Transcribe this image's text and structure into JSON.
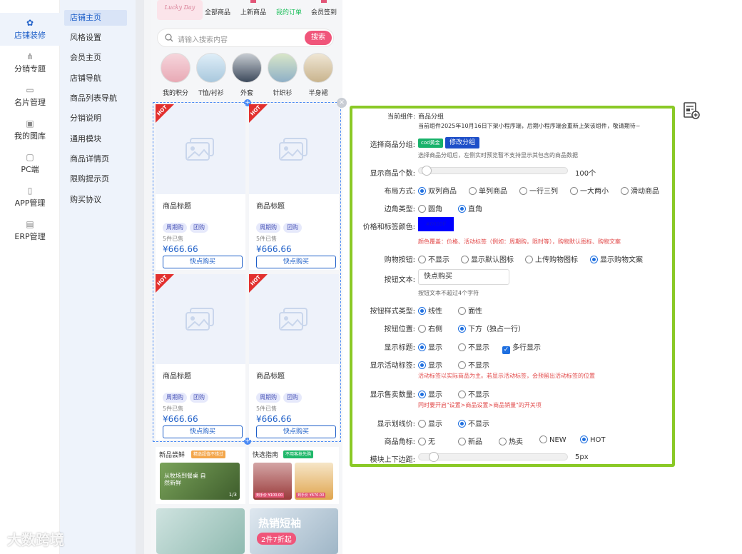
{
  "rail": {
    "items": [
      {
        "label": "店铺装修",
        "icon": "palette-icon"
      },
      {
        "label": "分销专题",
        "icon": "share-icon"
      },
      {
        "label": "名片管理",
        "icon": "card-icon"
      },
      {
        "label": "我的图库",
        "icon": "image-icon"
      },
      {
        "label": "PC端",
        "icon": "monitor-icon"
      },
      {
        "label": "APP管理",
        "icon": "phone-icon"
      },
      {
        "label": "ERP管理",
        "icon": "keyboard-icon"
      }
    ]
  },
  "submenu": {
    "items": [
      "店铺主页",
      "风格设置",
      "会员主页",
      "店铺导航",
      "商品列表导航",
      "分销说明",
      "通用模块",
      "商品详情页",
      "限购提示页",
      "购买协议"
    ]
  },
  "preview": {
    "logo": "Lucky Day",
    "topnav": [
      "全部商品",
      "上新商品",
      "我的订单",
      "会员签到"
    ],
    "search_placeholder": "请输入搜索内容",
    "search_button": "搜索",
    "categories": [
      "我的积分",
      "T恤/衬衫",
      "外套",
      "针织衫",
      "半身裙"
    ],
    "products": [
      {
        "badge": "HOT",
        "title": "商品标题",
        "tags": [
          "周期购",
          "团购"
        ],
        "sold": "5件已售",
        "price": "¥666.66",
        "button": "快点购买"
      },
      {
        "badge": "HOT",
        "title": "商品标题",
        "tags": [
          "周期购",
          "团购"
        ],
        "sold": "5件已售",
        "price": "¥666.66",
        "button": "快点购买"
      },
      {
        "badge": "HOT",
        "title": "商品标题",
        "tags": [
          "周期购",
          "团购"
        ],
        "sold": "5件已售",
        "price": "¥666.66",
        "button": "快点购买"
      },
      {
        "badge": "HOT",
        "title": "商品标题",
        "tags": [
          "周期购",
          "团购"
        ],
        "sold": "5件已售",
        "price": "¥666.66",
        "button": "快点购买"
      }
    ],
    "promos": [
      {
        "title": "新品尝鲜",
        "badge": "精选超值不错过",
        "caption": "从牧场到餐桌 自然新鲜",
        "page": "1/3"
      },
      {
        "title": "快选指南",
        "badge": "不用客抢先购",
        "price_a": "到手价 ¥100.00",
        "price_b": "到手价 ¥670.00"
      }
    ],
    "banner_text": "热销短袖",
    "banner_sub": "2件7折起"
  },
  "settings": {
    "current_label": "当前组件:",
    "current_value": "商品分组",
    "current_note": "当前组件2025年10月16日下架小程序端，后期小程序端会重新上架该组件，敬请期待~",
    "group_label": "选择商品分组:",
    "group_tag": "cod黄金",
    "group_button": "修改分组",
    "group_note": "选择商品分组后，左侧实时预览暂不支持显示其包含的商品数据",
    "count_label": "显示商品个数:",
    "count_value": "100个",
    "count_fraction": 0.02,
    "layout_label": "布局方式:",
    "layout_options": [
      "双列商品",
      "单列商品",
      "一行三列",
      "一大两小",
      "滑动商品"
    ],
    "corner_label": "边角类型:",
    "corner_options": [
      "圆角",
      "直角"
    ],
    "color_label": "价格和标签颜色:",
    "color_value": "#0000ff",
    "color_swatch_text": "#0000ff",
    "color_note": "颜色覆盖：价格、活动标签（例如：周期购，限时等），购物默认图标、购物文案",
    "cart_label": "购物按钮:",
    "cart_options": [
      "不显示",
      "显示默认图标",
      "上传购物图标",
      "显示购物文案"
    ],
    "btntext_label": "按钮文本:",
    "btntext_value": "快点购买",
    "btntext_note": "按钮文本不超过4个字符",
    "btnstyle_label": "按钮样式类型:",
    "btnstyle_options": [
      "线性",
      "面性"
    ],
    "btnpos_label": "按钮位置:",
    "btnpos_options": [
      "右侧",
      "下方（独占一行）"
    ],
    "title_label": "显示标题:",
    "title_options": [
      "显示",
      "不显示"
    ],
    "title_multiline": "多行显示",
    "activity_label": "显示活动标签:",
    "activity_options": [
      "显示",
      "不显示"
    ],
    "activity_note": "活动标签以实际商品为主。若显示活动标签，会预留出活动标签的位置",
    "sales_label": "显示售卖数量:",
    "sales_options": [
      "显示",
      "不显示"
    ],
    "sales_note": "同时要开启\"设置>商品设置>商品销量\"的开关项",
    "strike_label": "显示划线价:",
    "strike_options": [
      "显示",
      "不显示"
    ],
    "corner_mark_label": "商品角标:",
    "corner_mark_options": [
      "无",
      "新品",
      "热卖",
      "NEW",
      "HOT"
    ],
    "margin_label": "模块上下边距:",
    "margin_value": "5px",
    "margin_fraction": 0.05
  },
  "watermark": "大数跨境",
  "colors": {
    "accent": "#1e5fc8",
    "panel_border": "#8ac926",
    "search_button": "#f0557a",
    "hot_badge": "#e2302e"
  }
}
